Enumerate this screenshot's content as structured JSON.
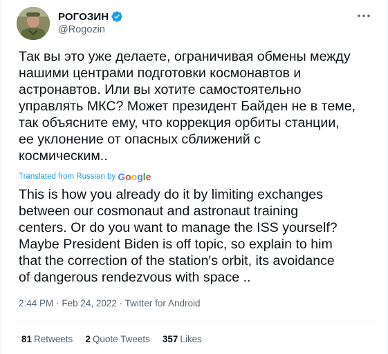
{
  "author": {
    "display_name": "РОГОЗИН",
    "handle": "@Rogozin",
    "verified_icon": "verified-badge-icon",
    "avatar_icon": "profile-photo"
  },
  "tweet": {
    "text_ru": "Так вы это уже делаете, ограничивая обмены между\nнашими центрами подготовки космонавтов и\nастронавтов. Или вы хотите самостоятельно\nуправлять МКС? Может президент Байден не в теме,\nтак объясните ему, что коррекция орбиты станции,\nее уклонение от опасных сближений с\nкосмическим..",
    "translated_label": "Translated from Russian by",
    "translation_provider": "Google",
    "text_en": "This is how you already do it by limiting exchanges\nbetween our cosmonaut and astronaut training\ncenters. Or do you want to manage the ISS yourself?\nMaybe President Biden is off topic, so explain to him\nthat the correction of the station's orbit, its avoidance\nof dangerous rendezvous with space ..",
    "time": "2:44 PM",
    "date": "Feb 24, 2022",
    "source": "Twitter for Android",
    "separator": "·"
  },
  "stats": {
    "retweets_count": "81",
    "retweets_label": "Retweets",
    "quote_count": "2",
    "quote_label": "Quote Tweets",
    "likes_count": "357",
    "likes_label": "Likes"
  },
  "colors": {
    "accent": "#1d9bf0",
    "text_primary": "#0f1419",
    "text_secondary": "#536471",
    "divider": "#eff3f4"
  }
}
